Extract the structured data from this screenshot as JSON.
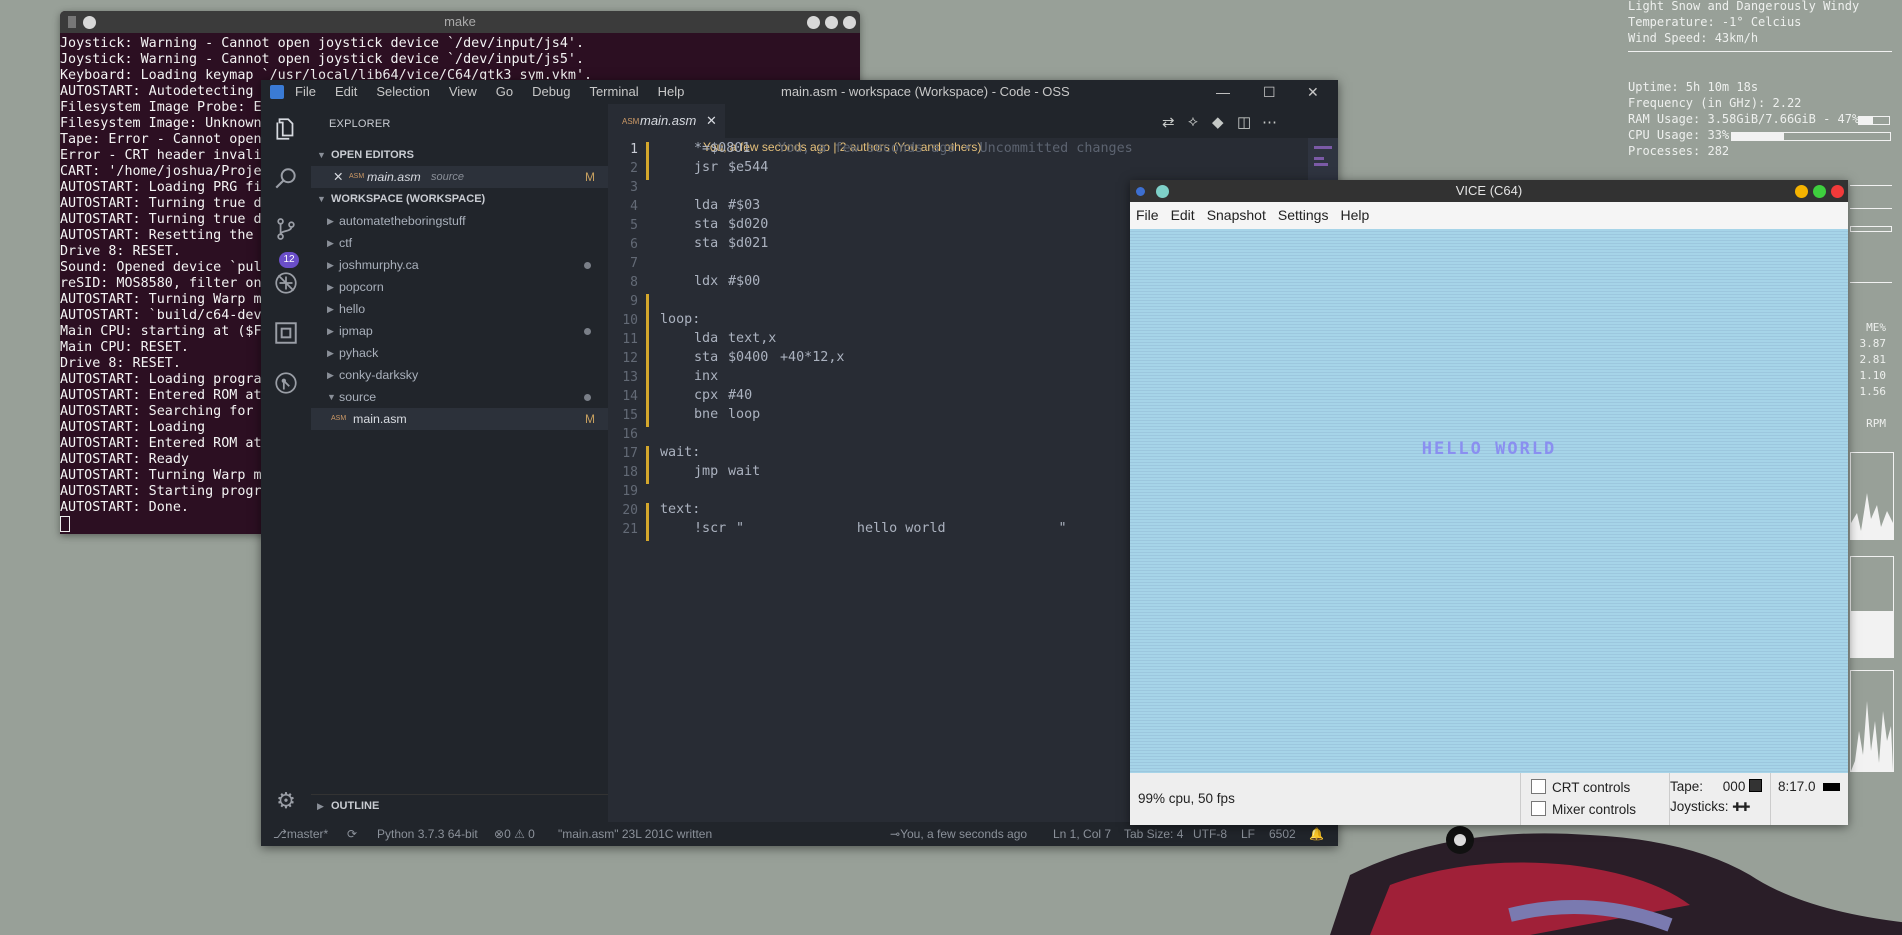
{
  "conky": {
    "weather": [
      "Light Snow and Dangerously Windy",
      "Temperature: -1° Celcius",
      "Wind Speed: 43km/h"
    ],
    "stats": [
      "Uptime: 5h 10m 18s",
      "Frequency (in GHz): 2.22",
      "RAM Usage: 3.58GiB/7.66GiB - 47%",
      "CPU Usage: 33%",
      "Processes: 282"
    ],
    "ram_fraction": 0.47,
    "cpu_fraction": 0.33,
    "load_header": "ME%",
    "loads": [
      "3.87",
      "2.81",
      "1.10",
      "1.56"
    ],
    "rpm_label": "RPM"
  },
  "terminal": {
    "title": "make",
    "lines": [
      "Joystick: Warning - Cannot open joystick device `/dev/input/js4'.",
      "Joystick: Warning - Cannot open joystick device `/dev/input/js5'.",
      "Keyboard: Loading keymap `/usr/local/lib64/vice/C64/gtk3_sym.vkm'.",
      "AUTOSTART: Autodetecting",
      "Filesystem Image Probe: E",
      "Filesystem Image: Unknown",
      "Tape: Error - Cannot open",
      "Error - CRT header invali",
      "CART: '/home/joshua/Proje",
      "AUTOSTART: Loading PRG fi",
      "AUTOSTART: Turning true d",
      "AUTOSTART: Turning true d",
      "AUTOSTART: Resetting the",
      "Drive 8: RESET.",
      "Sound: Opened device `pul",
      "reSID: MOS8580, filter on",
      "AUTOSTART: Turning Warp m",
      "AUTOSTART: `build/c64-dev",
      "Main CPU: starting at ($F",
      "Main CPU: RESET.",
      "Drive 8: RESET.",
      "AUTOSTART: Loading progra",
      "AUTOSTART: Entered ROM at",
      "AUTOSTART: Searching for",
      "AUTOSTART: Loading",
      "AUTOSTART: Entered ROM at",
      "AUTOSTART: Ready",
      "AUTOSTART: Turning Warp m",
      "AUTOSTART: Starting progr",
      "AUTOSTART: Done."
    ]
  },
  "vscode": {
    "menu": [
      "File",
      "Edit",
      "Selection",
      "View",
      "Go",
      "Debug",
      "Terminal",
      "Help"
    ],
    "window_title": "main.asm - workspace (Workspace) - Code - OSS",
    "scm_badge": "12",
    "explorer_title": "EXPLORER",
    "open_editors_label": "OPEN EDITORS",
    "open_editor": {
      "name": "main.asm",
      "folder": "source",
      "status": "M"
    },
    "workspace_label": "WORKSPACE (WORKSPACE)",
    "tree": [
      {
        "name": "automatetheboringstuff",
        "modified": false
      },
      {
        "name": "ctf",
        "modified": false
      },
      {
        "name": "joshmurphy.ca",
        "modified": true
      },
      {
        "name": "popcorn",
        "modified": false
      },
      {
        "name": "hello",
        "modified": false
      },
      {
        "name": "ipmap",
        "modified": true
      },
      {
        "name": "pyhack",
        "modified": false
      },
      {
        "name": "conky-darksky",
        "modified": false
      },
      {
        "name": "source",
        "modified": true
      }
    ],
    "tree_file": {
      "name": "main.asm",
      "status": "M"
    },
    "outline_label": "OUTLINE",
    "tab_name": "main.asm",
    "blame": "You, a few seconds ago | 2 authors (You and others)",
    "inline_blame": "You, a few seconds ago • Uncommitted changes",
    "line_numbers": [
      "1",
      "2",
      "3",
      "4",
      "5",
      "6",
      "7",
      "8",
      "9",
      "10",
      "11",
      "12",
      "13",
      "14",
      "15",
      "16",
      "17",
      "18",
      "19",
      "20",
      "21"
    ],
    "code": {
      "l1": "*=$0801",
      "l2a": "jsr",
      "l2b": "$e544",
      "l4a": "lda",
      "l4b": "#$03",
      "l5a": "sta",
      "l5b": "$d020",
      "l6a": "sta",
      "l6b": "$d021",
      "l8a": "ldx",
      "l8b": "#$00",
      "l10": "loop:",
      "l11a": "lda",
      "l11b": "text,x",
      "l12a": "sta",
      "l12b": "$0400",
      "l12c": "+40*12,x",
      "l13": "inx",
      "l14a": "cpx",
      "l14b": "#40",
      "l15a": "bne",
      "l15b": "loop",
      "l17": "wait:",
      "l18a": "jmp",
      "l18b": "wait",
      "l20": "text:",
      "l21a": "!scr",
      "l21b": "\"              hello world              \""
    },
    "status": {
      "branch": "master*",
      "python": "Python 3.7.3 64-bit",
      "problems": "0 ⚠ 0",
      "message": "\"main.asm\" 23L 201C written",
      "blame": "You, a few seconds ago",
      "position": "Ln 1, Col 7",
      "tab_size": "Tab Size: 4",
      "encoding": "UTF-8",
      "eol": "LF",
      "lang": "6502"
    }
  },
  "vice": {
    "title": "VICE (C64)",
    "menu": [
      "File",
      "Edit",
      "Snapshot",
      "Settings",
      "Help"
    ],
    "screen_text": "HELLO WORLD",
    "cpu": "99% cpu, 50 fps",
    "crt_controls": "CRT controls",
    "mixer_controls": "Mixer controls",
    "tape_label": "Tape:",
    "tape_counter": "000",
    "time": "8:17.0",
    "joysticks_label": "Joysticks:"
  },
  "colors": {
    "desktop": "#98a098",
    "terminal_bg": "#2c0f22",
    "editor_bg": "#282c34",
    "sidebar_bg": "#21252b",
    "c64_screen": "#a6d4e8",
    "c64_text": "#8a8ff0",
    "git_modified": "#d4a72c"
  }
}
